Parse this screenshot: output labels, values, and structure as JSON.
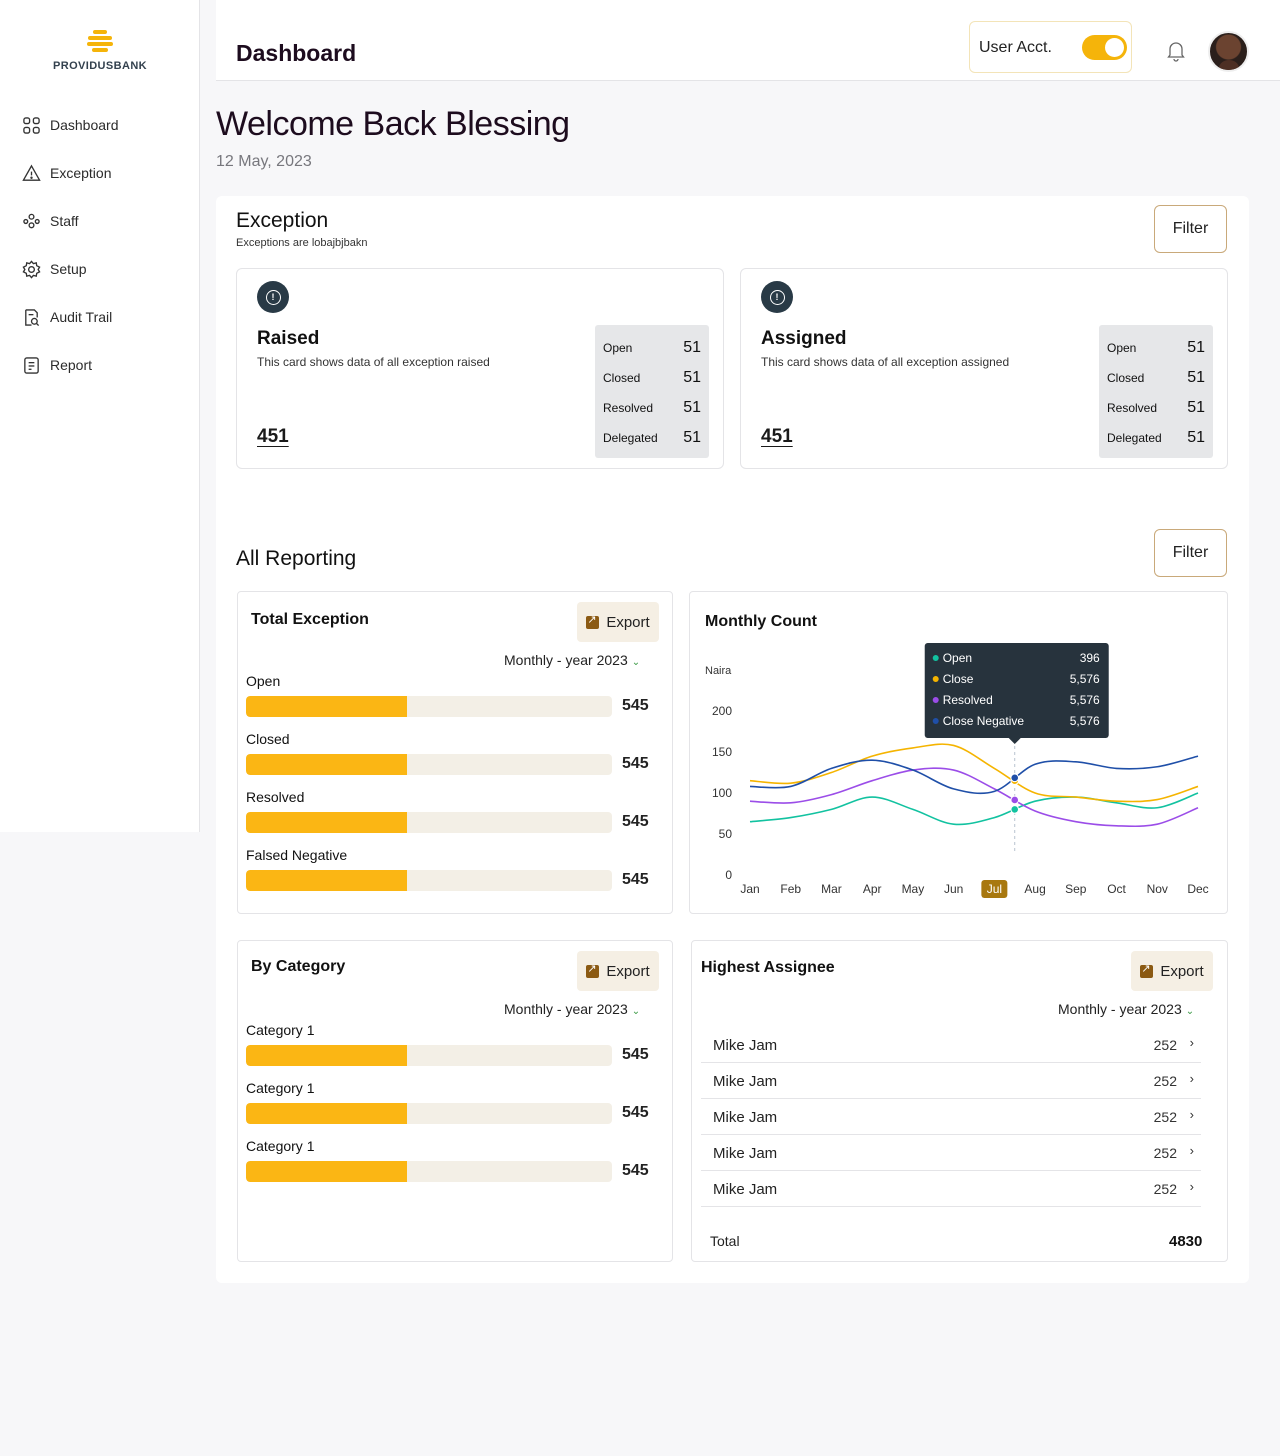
{
  "brand": {
    "name": "PROVIDUSBANK",
    "color": "#f5b40a"
  },
  "sidebar": {
    "items": [
      {
        "label": "Dashboard",
        "icon": "grid-icon"
      },
      {
        "label": "Exception",
        "icon": "warning-icon"
      },
      {
        "label": "Staff",
        "icon": "people-icon"
      },
      {
        "label": "Setup",
        "icon": "gear-icon"
      },
      {
        "label": "Audit Trail",
        "icon": "document-search-icon"
      },
      {
        "label": "Report",
        "icon": "report-icon"
      }
    ]
  },
  "header": {
    "title": "Dashboard",
    "user_acct_label": "User Acct.",
    "user_acct_toggle": true
  },
  "welcome": {
    "heading": "Welcome Back Blessing",
    "date": "12 May, 2023"
  },
  "exception": {
    "title": "Exception",
    "subtitle": "Exceptions are lobajbjbakn",
    "filter_label": "Filter",
    "cards": [
      {
        "title": "Raised",
        "desc": "This card shows data of all exception raised",
        "total": "451",
        "stats": [
          {
            "label": "Open",
            "value": "51"
          },
          {
            "label": "Closed",
            "value": "51"
          },
          {
            "label": "Resolved",
            "value": "51"
          },
          {
            "label": "Delegated",
            "value": "51"
          }
        ]
      },
      {
        "title": "Assigned",
        "desc": "This card shows data of all exception assigned",
        "total": "451",
        "stats": [
          {
            "label": "Open",
            "value": "51"
          },
          {
            "label": "Closed",
            "value": "51"
          },
          {
            "label": "Resolved",
            "value": "51"
          },
          {
            "label": "Delegated",
            "value": "51"
          }
        ]
      }
    ]
  },
  "reporting": {
    "title": "All Reporting",
    "filter_label": "Filter",
    "export_label": "Export",
    "period_label": "Monthly - year 2023",
    "total_exception": {
      "title": "Total Exception",
      "items": [
        {
          "label": "Open",
          "value": "545",
          "fill": 0.44
        },
        {
          "label": "Closed",
          "value": "545",
          "fill": 0.44
        },
        {
          "label": "Resolved",
          "value": "545",
          "fill": 0.44
        },
        {
          "label": "Falsed Negative",
          "value": "545",
          "fill": 0.44
        }
      ]
    },
    "by_category": {
      "title": "By Category",
      "items": [
        {
          "label": "Category 1",
          "value": "545",
          "fill": 0.44
        },
        {
          "label": "Category 1",
          "value": "545",
          "fill": 0.44
        },
        {
          "label": "Category 1",
          "value": "545",
          "fill": 0.44
        }
      ]
    },
    "highest_assignee": {
      "title": "Highest Assignee",
      "rows": [
        {
          "name": "Mike Jam",
          "count": "252"
        },
        {
          "name": "Mike Jam",
          "count": "252"
        },
        {
          "name": "Mike Jam",
          "count": "252"
        },
        {
          "name": "Mike Jam",
          "count": "252"
        },
        {
          "name": "Mike Jam",
          "count": "252"
        }
      ],
      "total_label": "Total",
      "total_value": "4830"
    },
    "monthly_count": {
      "title": "Monthly Count"
    }
  },
  "chart_data": {
    "type": "line",
    "title": "Monthly Count",
    "ylabel": "Naira",
    "xlabel": "",
    "categories": [
      "Jan",
      "Feb",
      "Mar",
      "Apr",
      "May",
      "Jun",
      "Jul",
      "Aug",
      "Sep",
      "Oct",
      "Nov",
      "Dec"
    ],
    "yticks": [
      0,
      50,
      100,
      150,
      200
    ],
    "ylim": [
      0,
      200
    ],
    "highlighted_category": "Jul",
    "series": [
      {
        "name": "Open",
        "color": "#12c2a0",
        "values": [
          65,
          70,
          80,
          95,
          80,
          62,
          70,
          90,
          95,
          88,
          82,
          100
        ]
      },
      {
        "name": "Close",
        "color": "#f5b400",
        "values": [
          115,
          112,
          125,
          145,
          155,
          158,
          130,
          100,
          95,
          90,
          92,
          108
        ]
      },
      {
        "name": "Resolved",
        "color": "#9b4de8",
        "values": [
          90,
          88,
          98,
          115,
          128,
          128,
          105,
          78,
          65,
          60,
          62,
          82
        ]
      },
      {
        "name": "Close Negative",
        "color": "#1f4fa8",
        "values": [
          108,
          108,
          130,
          140,
          128,
          105,
          102,
          135,
          138,
          130,
          132,
          145
        ]
      }
    ],
    "tooltip": {
      "rows": [
        {
          "name": "Open",
          "value": "396",
          "color": "#12c2a0"
        },
        {
          "name": "Close",
          "value": "5,576",
          "color": "#f5b400"
        },
        {
          "name": "Resolved",
          "value": "5,576",
          "color": "#9b4de8"
        },
        {
          "name": "Close Negative",
          "value": "5,576",
          "color": "#1f4fa8"
        }
      ]
    },
    "grid": false,
    "legend": "none"
  }
}
